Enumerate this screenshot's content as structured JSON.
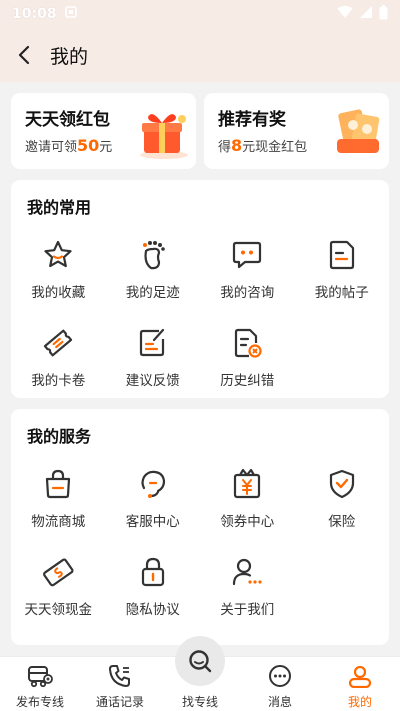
{
  "status": {
    "time": "10:08"
  },
  "header": {
    "title": "我的"
  },
  "promos": [
    {
      "title": "天天领红包",
      "sub_prefix": "邀请可领",
      "sub_value": "50",
      "sub_suffix": "元"
    },
    {
      "title": "推荐有奖",
      "sub_prefix": "得",
      "sub_value": "8",
      "sub_suffix": "元现金红包"
    }
  ],
  "common": {
    "title": "我的常用",
    "items": [
      {
        "label": "我的收藏",
        "icon": "star-icon"
      },
      {
        "label": "我的足迹",
        "icon": "footprint-icon"
      },
      {
        "label": "我的咨询",
        "icon": "chat-bubble-icon"
      },
      {
        "label": "我的帖子",
        "icon": "document-icon"
      },
      {
        "label": "我的卡卷",
        "icon": "ticket-icon"
      },
      {
        "label": "建议反馈",
        "icon": "feedback-icon"
      },
      {
        "label": "历史纠错",
        "icon": "history-correction-icon"
      }
    ]
  },
  "services": {
    "title": "我的服务",
    "items": [
      {
        "label": "物流商城",
        "icon": "shopping-bag-icon"
      },
      {
        "label": "客服中心",
        "icon": "headset-icon"
      },
      {
        "label": "领券中心",
        "icon": "coupon-icon"
      },
      {
        "label": "保险",
        "icon": "shield-check-icon"
      },
      {
        "label": "天天领现金",
        "icon": "cash-icon"
      },
      {
        "label": "隐私协议",
        "icon": "lock-icon"
      },
      {
        "label": "关于我们",
        "icon": "person-info-icon"
      }
    ]
  },
  "tabbar": {
    "tabs": [
      {
        "label": "发布专线",
        "icon": "truck-icon"
      },
      {
        "label": "通话记录",
        "icon": "phone-icon"
      },
      {
        "label": "找专线",
        "icon": "search-icon"
      },
      {
        "label": "消息",
        "icon": "message-icon"
      },
      {
        "label": "我的",
        "icon": "profile-icon"
      }
    ],
    "active_index": 4
  },
  "colors": {
    "accent": "#ff6a00",
    "header_bg": "#f7ebe6",
    "page_bg": "#f2f2f2"
  }
}
